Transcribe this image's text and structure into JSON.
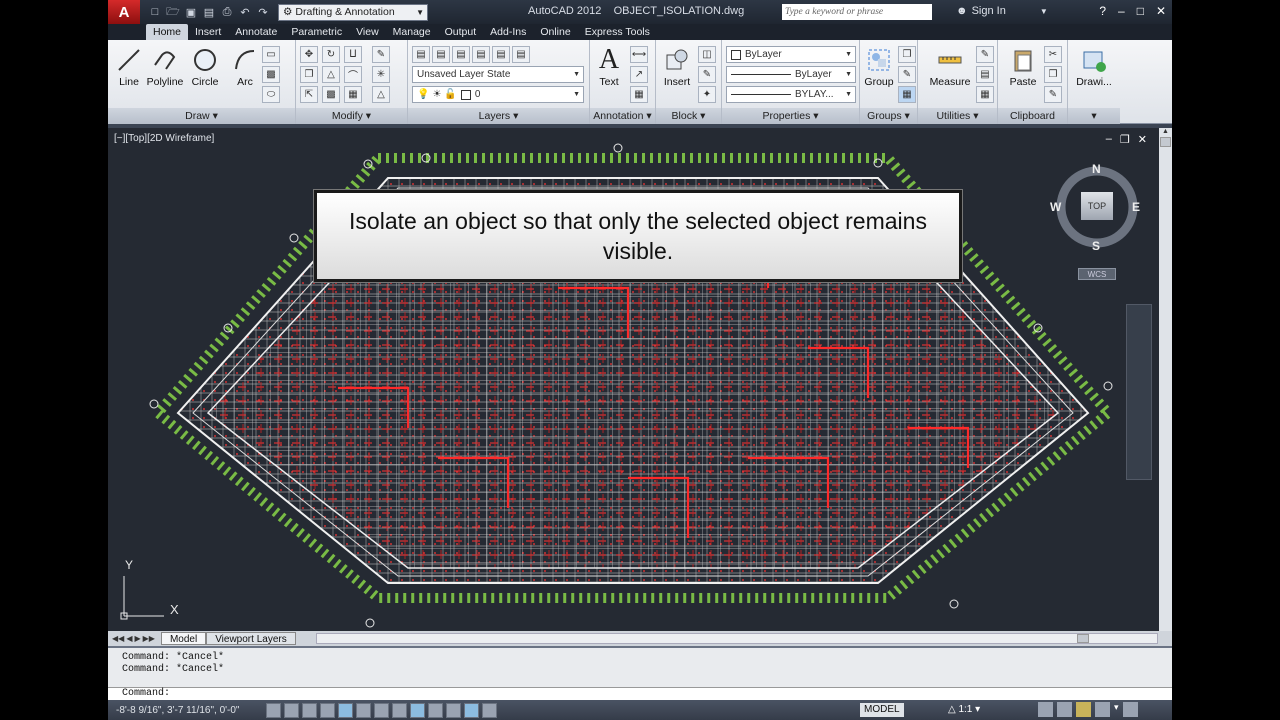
{
  "titlebar": {
    "app_logo": "A",
    "workspace": "Drafting & Annotation",
    "title": "AutoCAD 2012    OBJECT_ISOLATION.dwg",
    "search_placeholder": "Type a keyword or phrase",
    "signin": "Sign In"
  },
  "tabs": [
    "Home",
    "Insert",
    "Annotate",
    "Parametric",
    "View",
    "Manage",
    "Output",
    "Add-Ins",
    "Online",
    "Express Tools"
  ],
  "ribbon": {
    "draw": {
      "title": "Draw",
      "line": "Line",
      "polyline": "Polyline",
      "circle": "Circle",
      "arc": "Arc"
    },
    "modify": {
      "title": "Modify"
    },
    "layers": {
      "title": "Layers",
      "layer_state": "Unsaved Layer State",
      "current_layer": "0"
    },
    "annotation": {
      "title": "Annotation",
      "text": "Text"
    },
    "block": {
      "title": "Block",
      "insert": "Insert"
    },
    "properties": {
      "title": "Properties",
      "color": "ByLayer",
      "linetype": "ByLayer",
      "lineweight": "BYLAY..."
    },
    "groups": {
      "title": "Groups",
      "group": "Group"
    },
    "utilities": {
      "title": "Utilities",
      "measure": "Measure"
    },
    "clipboard": {
      "title": "Clipboard",
      "paste": "Paste"
    },
    "view": {
      "draw": "Drawi..."
    }
  },
  "viewport": {
    "label": "[−][Top][2D Wireframe]",
    "compass": {
      "n": "N",
      "s": "S",
      "e": "E",
      "w": "W",
      "top": "TOP",
      "wcs": "WCS"
    },
    "ucs": {
      "x": "X",
      "y": "Y"
    }
  },
  "callout": "Isolate an object so that only the selected object remains visible.",
  "layout_tabs": [
    "Model",
    "Viewport Layers"
  ],
  "command": {
    "history": [
      "Command: *Cancel*",
      "Command: *Cancel*"
    ],
    "prompt": "Command:"
  },
  "status": {
    "coords": "-8'-8 9/16\", 3'-7 11/16\", 0'-0\"",
    "model": "MODEL",
    "scale": "1:1"
  }
}
